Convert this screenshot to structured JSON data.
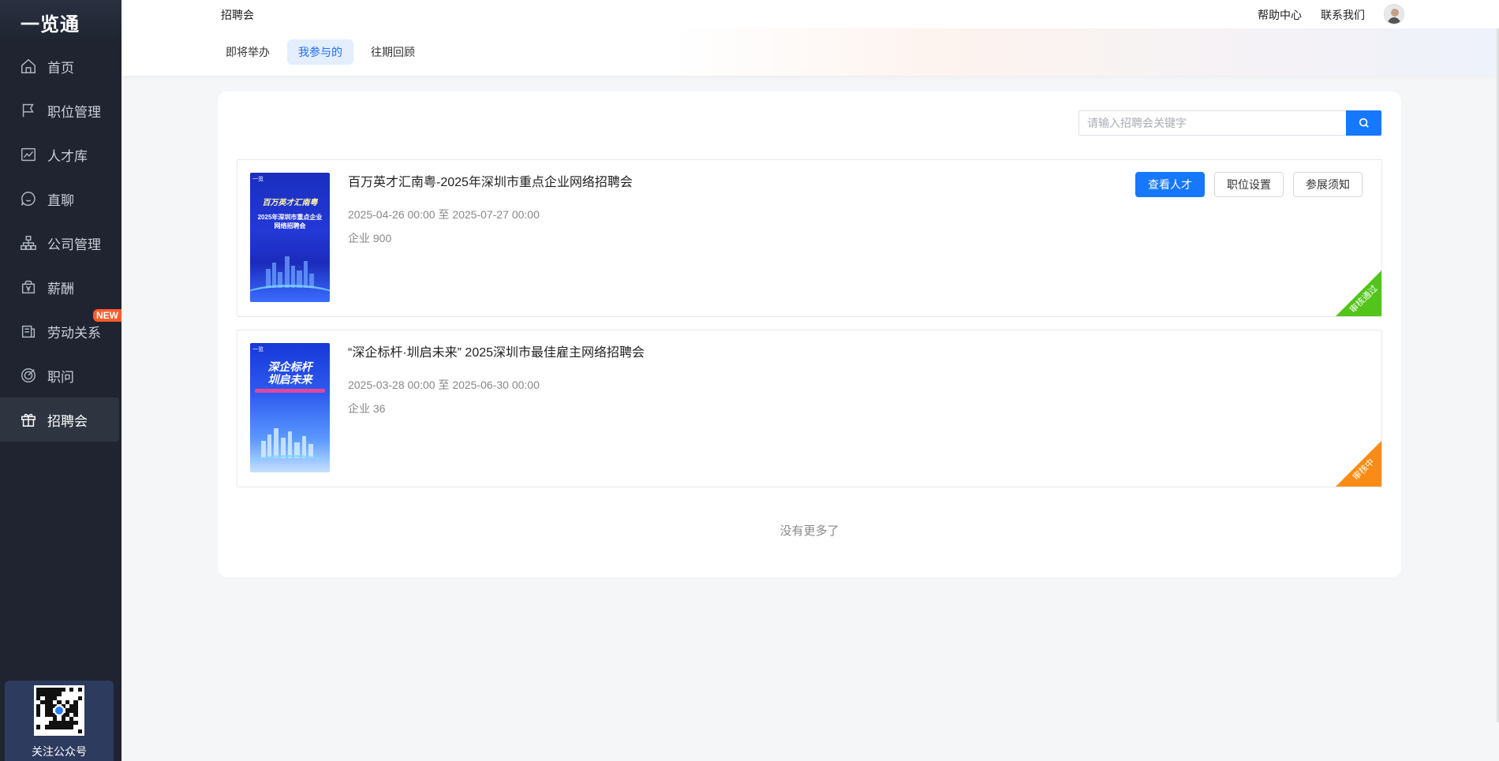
{
  "app": {
    "logo": "一览通"
  },
  "sidebar": {
    "items": [
      {
        "label": "首页",
        "icon": "home-icon"
      },
      {
        "label": "职位管理",
        "icon": "flag-icon"
      },
      {
        "label": "人才库",
        "icon": "chart-line-icon"
      },
      {
        "label": "直聊",
        "icon": "chat-icon"
      },
      {
        "label": "公司管理",
        "icon": "org-chart-icon"
      },
      {
        "label": "薪酬",
        "icon": "salary-icon"
      },
      {
        "label": "劳动关系",
        "icon": "document-icon",
        "badge": "NEW"
      },
      {
        "label": "职问",
        "icon": "target-icon"
      },
      {
        "label": "招聘会",
        "icon": "gift-icon",
        "active": true
      }
    ],
    "qr_label": "关注公众号"
  },
  "topbar": {
    "title": "招聘会",
    "help": "帮助中心",
    "contact": "联系我们"
  },
  "tabs": [
    {
      "label": "即将举办"
    },
    {
      "label": "我参与的",
      "active": true
    },
    {
      "label": "往期回顾"
    }
  ],
  "search": {
    "placeholder": "请输入招聘会关键字"
  },
  "fairs": [
    {
      "title": "百万英才汇南粤-2025年深圳市重点企业网络招聘会",
      "date": "2025-04-26 00:00 至 2025-07-27 00:00",
      "count": "企业 900",
      "status": "审核通过",
      "status_color": "#52c41a",
      "poster": {
        "corner": "一览",
        "line1": "百万英才汇南粤",
        "line2": "2025年深圳市重点企业",
        "line3": "网络招聘会"
      },
      "actions": {
        "view": "查看人才",
        "positions": "职位设置",
        "notice": "参展须知"
      }
    },
    {
      "title": "“深企标杆·圳启未来” 2025深圳市最佳雇主网络招聘会",
      "date": "2025-03-28 00:00 至 2025-06-30 00:00",
      "count": "企业 36",
      "status": "审核中",
      "status_color": "#fa8c16",
      "poster": {
        "corner": "一览",
        "line1": "深企标杆",
        "line2": "圳启未来"
      }
    }
  ],
  "footer": {
    "no_more": "没有更多了"
  },
  "colors": {
    "primary": "#1677ff",
    "sidebar_bg": "#1f2430"
  }
}
